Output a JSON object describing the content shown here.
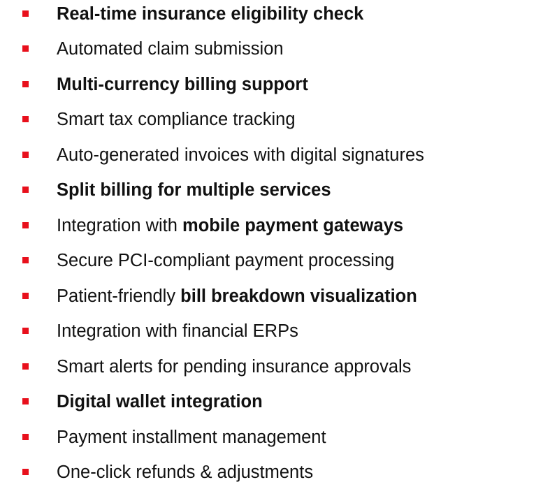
{
  "accent_color": "#e8101c",
  "features": [
    {
      "segments": [
        {
          "text": "Real-time insurance eligibility check",
          "bold": true
        }
      ]
    },
    {
      "segments": [
        {
          "text": "Automated claim submission",
          "bold": false
        }
      ]
    },
    {
      "segments": [
        {
          "text": "Multi-currency billing support",
          "bold": true
        }
      ]
    },
    {
      "segments": [
        {
          "text": "Smart tax compliance tracking",
          "bold": false
        }
      ]
    },
    {
      "segments": [
        {
          "text": "Auto-generated invoices with digital signatures",
          "bold": false
        }
      ]
    },
    {
      "segments": [
        {
          "text": "Split billing for multiple services",
          "bold": true
        }
      ]
    },
    {
      "segments": [
        {
          "text": "Integration with ",
          "bold": false
        },
        {
          "text": "mobile payment gateways",
          "bold": true
        }
      ]
    },
    {
      "segments": [
        {
          "text": "Secure PCI-compliant payment processing",
          "bold": false
        }
      ]
    },
    {
      "segments": [
        {
          "text": "Patient-friendly ",
          "bold": false
        },
        {
          "text": "bill breakdown visualization",
          "bold": true
        }
      ]
    },
    {
      "segments": [
        {
          "text": "Integration with financial ERPs",
          "bold": false
        }
      ]
    },
    {
      "segments": [
        {
          "text": "Smart alerts for pending insurance approvals",
          "bold": false
        }
      ]
    },
    {
      "segments": [
        {
          "text": "Digital wallet integration",
          "bold": true
        }
      ]
    },
    {
      "segments": [
        {
          "text": "Payment installment management",
          "bold": false
        }
      ]
    },
    {
      "segments": [
        {
          "text": "One-click refunds & adjustments",
          "bold": false
        }
      ]
    }
  ]
}
